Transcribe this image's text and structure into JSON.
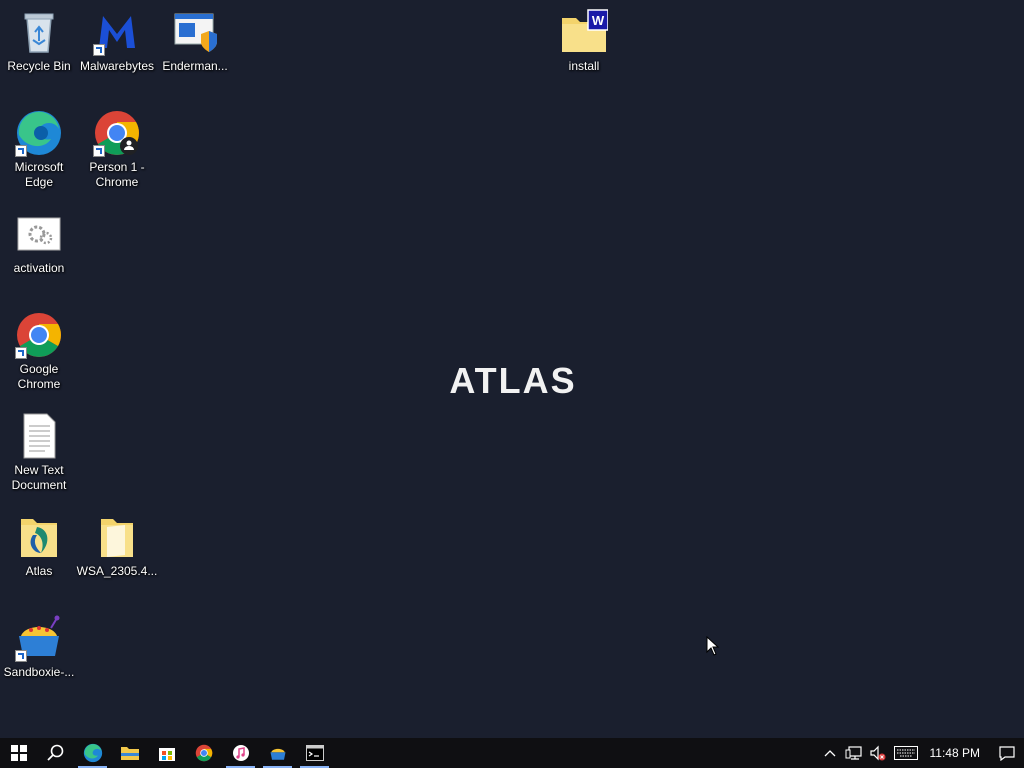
{
  "desktop": {
    "icons": [
      {
        "label": "Recycle Bin"
      },
      {
        "label": "Malwarebytes"
      },
      {
        "label": "Enderman..."
      },
      {
        "label": "install"
      },
      {
        "label": "Microsoft Edge"
      },
      {
        "label": "Person 1 - Chrome"
      },
      {
        "label": "activation"
      },
      {
        "label": "Google Chrome"
      },
      {
        "label": "New Text Document"
      },
      {
        "label": "Atlas"
      },
      {
        "label": "WSA_2305.4..."
      },
      {
        "label": "Sandboxie-..."
      }
    ],
    "logo_text": "ATLAS"
  },
  "taskbar": {
    "apps": [
      {
        "icon": "windows-start-icon"
      },
      {
        "icon": "search-icon"
      },
      {
        "icon": "edge-icon"
      },
      {
        "icon": "file-explorer-icon"
      },
      {
        "icon": "store-icon"
      },
      {
        "icon": "chrome-icon"
      },
      {
        "icon": "itunes-icon"
      },
      {
        "icon": "sandboxie-icon"
      },
      {
        "icon": "terminal-icon"
      }
    ],
    "clock": "11:48 PM"
  },
  "colors": {
    "background": "#1a1f2e",
    "taskbar": "#0f0f12",
    "active_indicator": "#8ab4f8"
  }
}
